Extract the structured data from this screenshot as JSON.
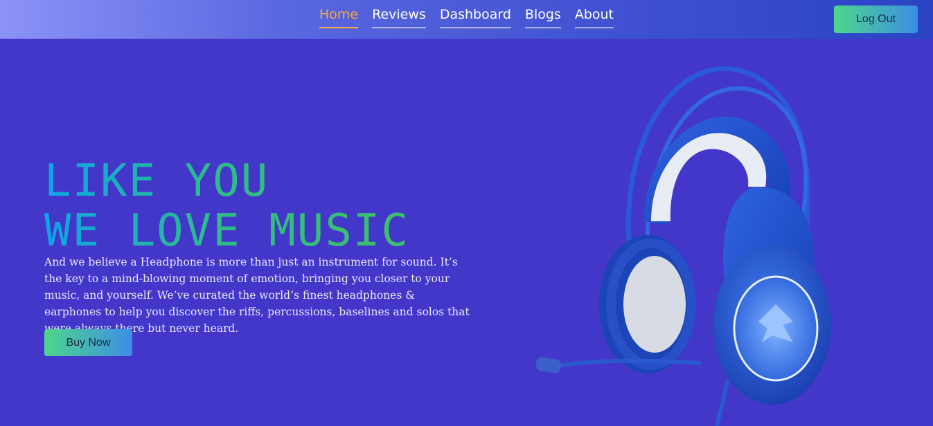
{
  "nav": {
    "links": [
      "Home",
      "Reviews",
      "Dashboard",
      "Blogs",
      "About"
    ],
    "active": "Home",
    "logout_label": "Log Out"
  },
  "hero": {
    "title_line1": "LIKE YOU",
    "title_line2": "WE LOVE MUSIC",
    "description": "And we believe a Headphone is more than just an instrument for sound. It’s the key to a mind-blowing moment of emotion, bringing you closer to your music, and yourself. We’ve curated the world’s finest headphones & earphones to help you discover the riffs, percussions, baselines and solos that were always there but never heard.",
    "cta_label": "Buy Now"
  },
  "colors": {
    "background": "#4237c9",
    "active_link": "#f5a93d",
    "button_gradient_start": "#4fd68b",
    "button_gradient_end": "#3c8de6",
    "headphone_blue": "#1f4fc8"
  },
  "images": {
    "hero_image": "blue-gaming-headset-with-mic"
  }
}
